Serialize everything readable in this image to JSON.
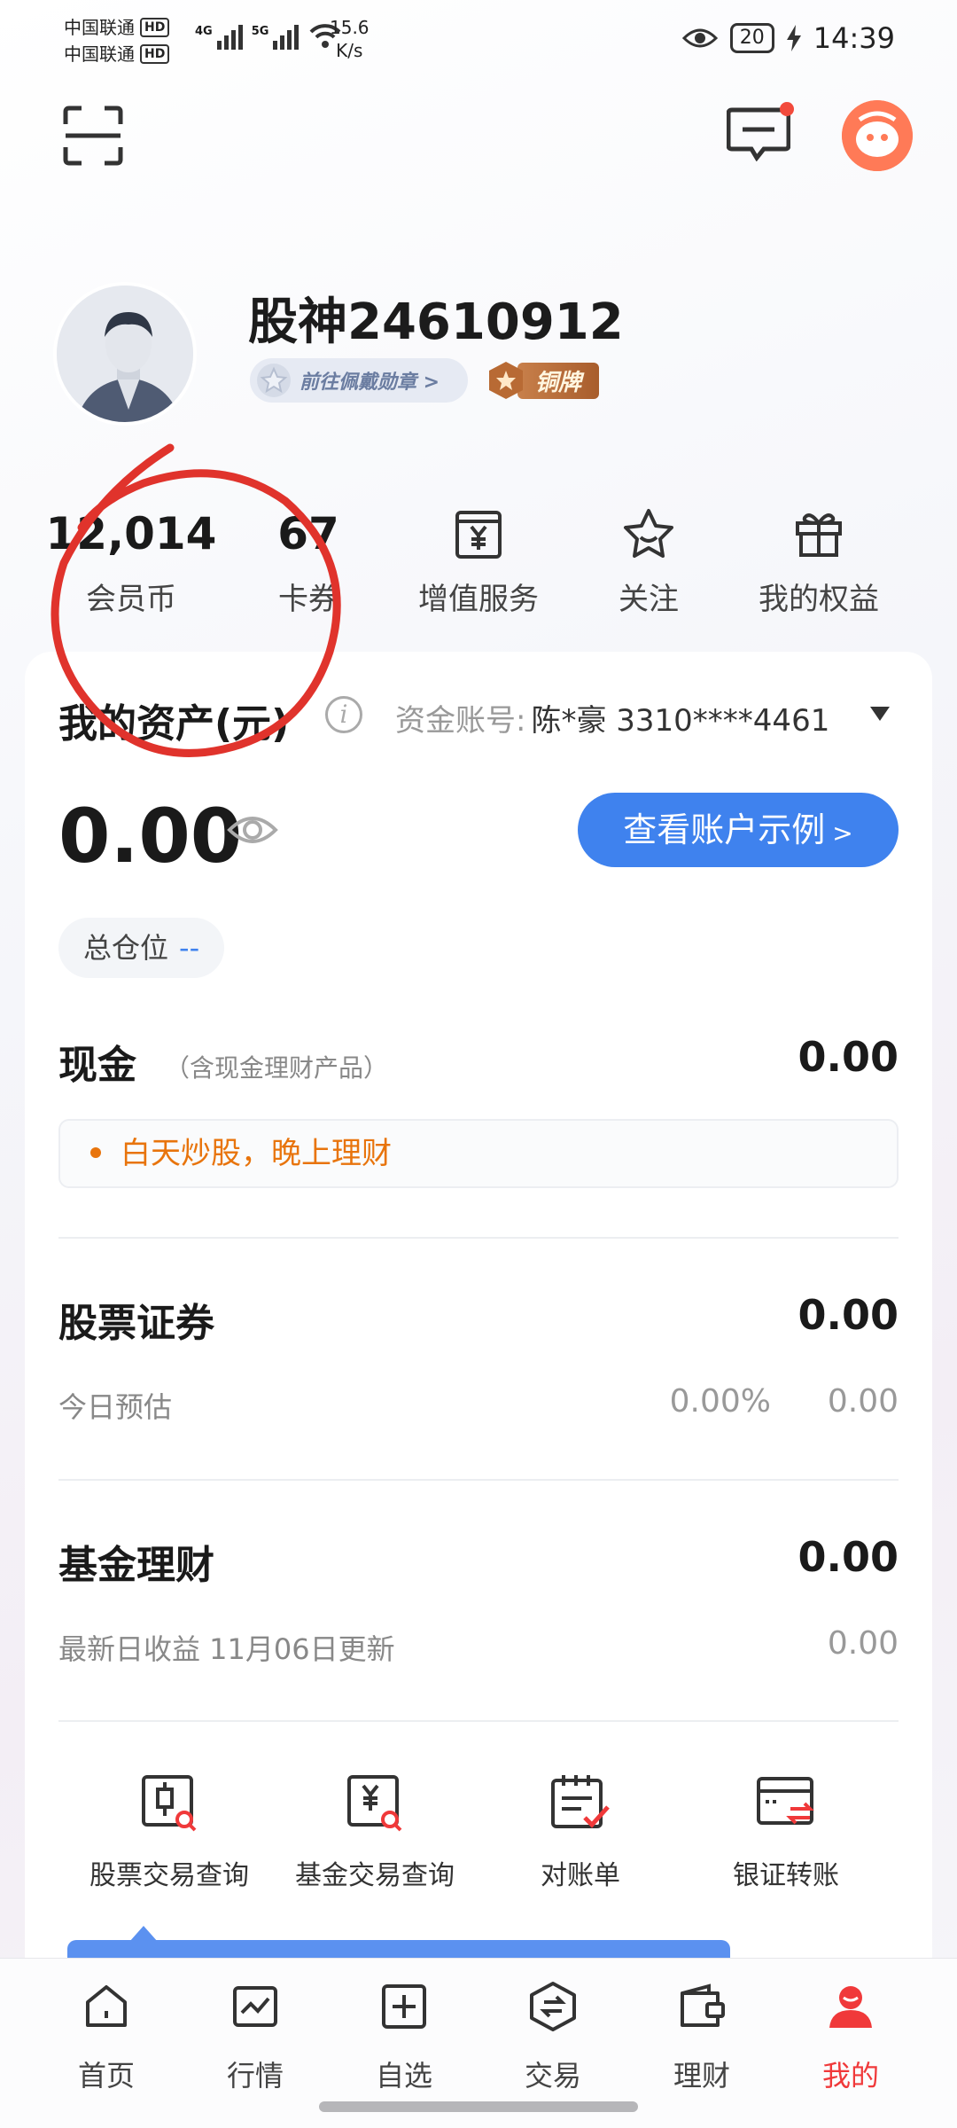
{
  "status_bar": {
    "carrier1": "中国联通",
    "carrier2": "中国联通",
    "hd": "HD",
    "net1": "4G",
    "net2": "5G",
    "speed_value": "15.6",
    "speed_unit": "K/s",
    "battery": "20",
    "time": "14:39"
  },
  "profile": {
    "username": "股神24610912",
    "medal_link": "前往佩戴勋章 >",
    "level": "铜牌"
  },
  "stats": [
    {
      "value": "12,014",
      "label": "会员币"
    },
    {
      "value": "67",
      "label": "卡券"
    },
    {
      "label": "增值服务",
      "icon": "yen-bill-icon"
    },
    {
      "label": "关注",
      "icon": "star-icon"
    },
    {
      "label": "我的权益",
      "icon": "gift-icon"
    }
  ],
  "assets": {
    "title": "我的资产(元)",
    "account_label": "资金账号:",
    "account_value": "陈*豪  3310****4461",
    "total": "0.00",
    "view_example": "查看账户示例",
    "view_arrow": ">",
    "position_label": "总仓位",
    "position_value": "--"
  },
  "cash": {
    "title": "现金",
    "note": "（含现金理财产品）",
    "value": "0.00",
    "tip": "白天炒股，晚上理财"
  },
  "stocks": {
    "title": "股票证券",
    "value": "0.00",
    "sub_label": "今日预估",
    "sub_pct": "0.00%",
    "sub_value": "0.00"
  },
  "funds": {
    "title": "基金理财",
    "value": "0.00",
    "sub_label": "最新日收益 11月06日更新",
    "sub_value": "0.00"
  },
  "tools": [
    {
      "label": "股票交易查询",
      "icon": "stock-query-icon"
    },
    {
      "label": "基金交易查询",
      "icon": "fund-query-icon"
    },
    {
      "label": "对账单",
      "icon": "statement-icon"
    },
    {
      "label": "银证转账",
      "icon": "bank-transfer-icon"
    }
  ],
  "nav": [
    {
      "label": "首页",
      "icon": "home-icon"
    },
    {
      "label": "行情",
      "icon": "market-chart-icon"
    },
    {
      "label": "自选",
      "icon": "add-watchlist-icon"
    },
    {
      "label": "交易",
      "icon": "trade-exchange-icon"
    },
    {
      "label": "理财",
      "icon": "wallet-icon"
    },
    {
      "label": "我的",
      "icon": "profile-icon"
    }
  ],
  "colors": {
    "accent_blue": "#3f82ee",
    "active_red": "#f0393a",
    "tip_orange": "#e8740c",
    "annotation_red": "#e0332c"
  }
}
